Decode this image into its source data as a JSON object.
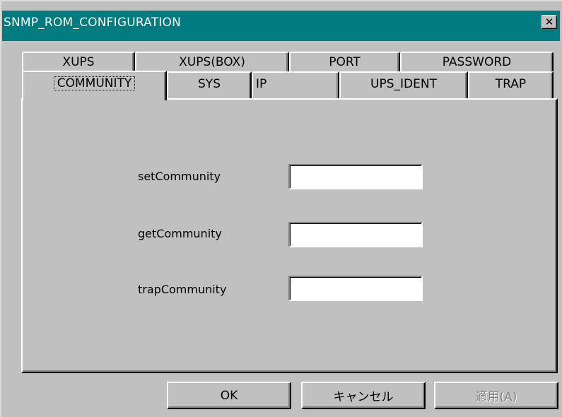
{
  "window": {
    "title": "SNMP_ROM_CONFIGURATION",
    "close_symbol": "✕",
    "title_bar_color": "#007b80"
  },
  "tabs": {
    "row1": [
      "XUPS",
      "XUPS(BOX)",
      "PORT",
      "PASSWORD"
    ],
    "row2": [
      "COMMUNITY",
      "SYS",
      "IP",
      "UPS_IDENT",
      "TRAP"
    ],
    "active": "COMMUNITY"
  },
  "community": {
    "set_label": "setCommunity",
    "set_value": "",
    "get_label": "getCommunity",
    "get_value": "",
    "trap_label": "trapCommunity",
    "trap_value": ""
  },
  "buttons": {
    "ok": "OK",
    "cancel": "キャンセル",
    "apply": "適用(A)",
    "apply_disabled": true
  }
}
